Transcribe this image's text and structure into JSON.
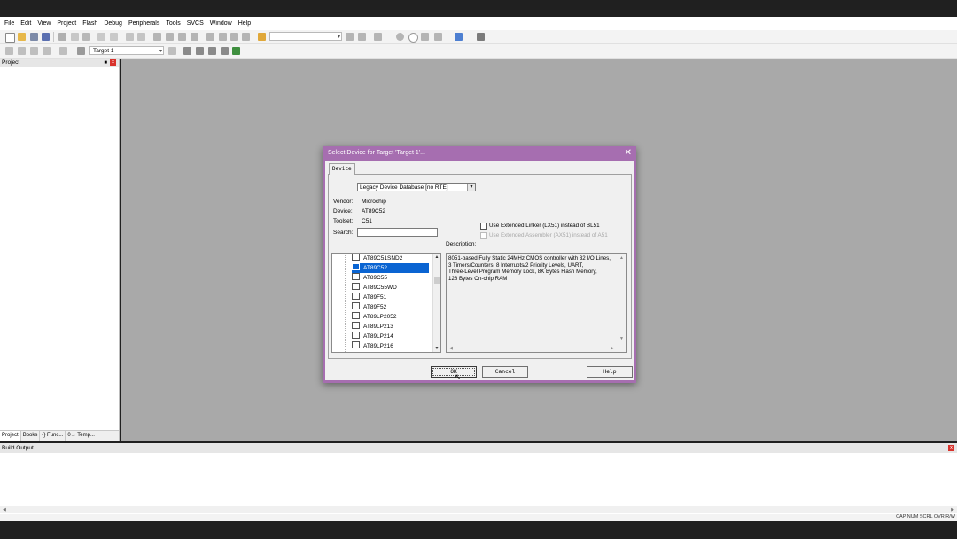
{
  "menu": [
    "File",
    "Edit",
    "View",
    "Project",
    "Flash",
    "Debug",
    "Peripherals",
    "Tools",
    "SVCS",
    "Window",
    "Help"
  ],
  "toolbar2": {
    "target_combo": "Target 1"
  },
  "project_panel": {
    "title": "Project",
    "pin": "⌂",
    "close": "x",
    "tabs": [
      "Project",
      "Books",
      "{} Func...",
      "0→ Temp..."
    ]
  },
  "build_output": {
    "title": "Build Output",
    "status_items": "CAP  NUM  SCRL  OVR  R/W"
  },
  "dialog": {
    "title": "Select Device for Target 'Target 1'...",
    "close": "✕",
    "tab": "Device",
    "database": "Legacy Device Database [no RTE]",
    "vendor_label": "Vendor:",
    "vendor": "Microchip",
    "device_label": "Device:",
    "device": "AT89C52",
    "toolset_label": "Toolset:",
    "toolset": "C51",
    "search_label": "Search:",
    "search_value": "",
    "checkbox_linker": "Use Extended Linker (LX51) instead of BL51",
    "checkbox_assembler": "Use Extended Assembler (AX51) instead of A51",
    "description_label": "Description:",
    "description": "8051-based Fully Static 24MHz CMOS controller with 32  I/O Lines,\n3 Timers/Counters, 8 Interrupts/2 Priority Levels, UART,\nThree-Level Program Memory Lock, 8K Bytes Flash Memory,\n128 Bytes On-chip RAM",
    "devices": [
      "AT89C51SND2",
      "AT89C52",
      "AT89C55",
      "AT89C55WD",
      "AT89F51",
      "AT89F52",
      "AT89LP2052",
      "AT89LP213",
      "AT89LP214",
      "AT89LP216"
    ],
    "selected_device": "AT89C52",
    "ok": "OK",
    "cancel": "Cancel",
    "help": "Help"
  },
  "colors": {
    "title_bar": "#a66eb0",
    "selection": "#0a64d2",
    "workspace": "#a9a9a9"
  }
}
